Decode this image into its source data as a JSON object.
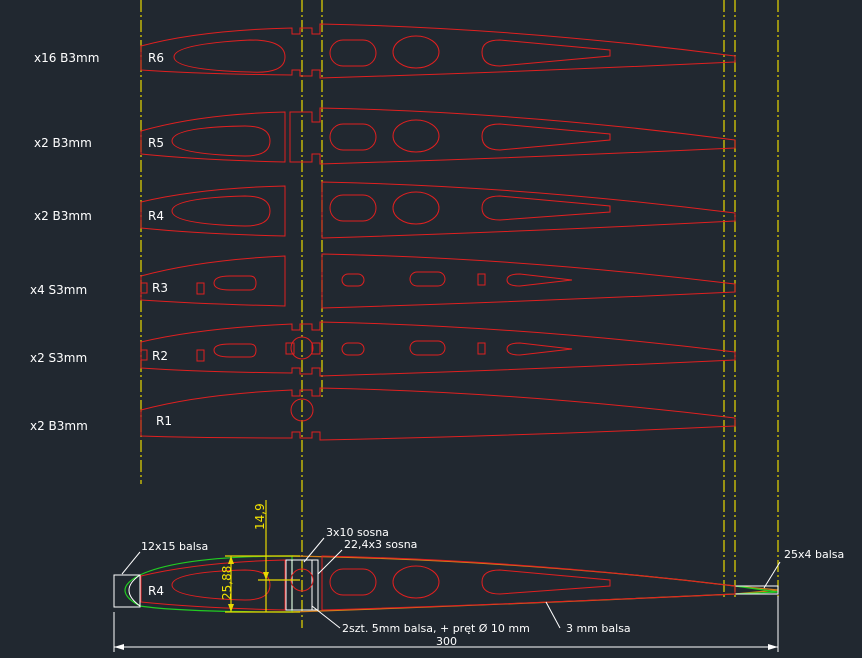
{
  "ribs": [
    {
      "name": "R6",
      "qty_label": "x16 B3mm"
    },
    {
      "name": "R5",
      "qty_label": "x2 B3mm"
    },
    {
      "name": "R4",
      "qty_label": "x2 B3mm"
    },
    {
      "name": "R3",
      "qty_label": "x4 S3mm"
    },
    {
      "name": "R2",
      "qty_label": "x2 S3mm"
    },
    {
      "name": "R1",
      "qty_label": "x2 B3mm"
    }
  ],
  "section": {
    "rib_name": "R4",
    "labels": {
      "leading_edge": "12x15 balsa",
      "spar_top": "3x10 sosna",
      "spar_main": "22,4x3 sosna",
      "trailing_edge": "25x4 balsa",
      "shear_web": "2szt. 5mm balsa, + pręt Ø 10 mm",
      "sheeting": "3 mm balsa"
    },
    "dimensions": {
      "spar_height": "14,9",
      "thickness": "25,88",
      "chord": "300"
    }
  },
  "colors": {
    "background": "#212830",
    "rib_outline": "#e02020",
    "centerline": "#e8d800",
    "sheeting": "#d4801a",
    "leading_edge": "#22cc22"
  }
}
